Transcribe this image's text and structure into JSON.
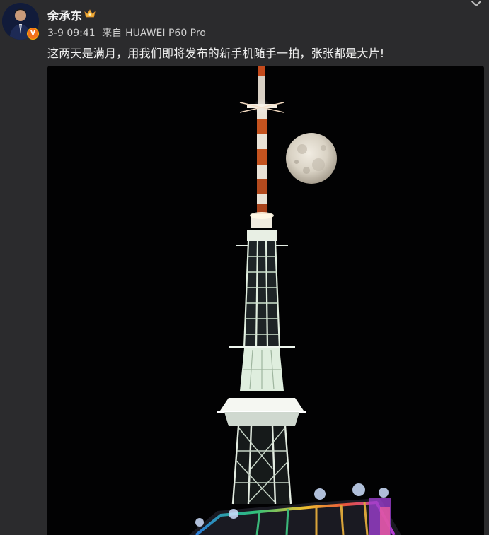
{
  "post": {
    "author": "余承东",
    "time": "3-9 09:41",
    "source_prefix": "来自",
    "device": "HUAWEI P60 Pro",
    "text": "这两天是满月，用我们即将发布的新手机随手一拍，张张都是大片!",
    "verified_mark": "V"
  },
  "icons": {
    "verified": "verified-badge-icon",
    "crown": "crown-icon",
    "more": "chevron-down-icon"
  },
  "colors": {
    "background": "#2b2b2d",
    "verified_badge": "#f2711c",
    "crown": "#f0b23a",
    "photo_background": "#020203"
  }
}
